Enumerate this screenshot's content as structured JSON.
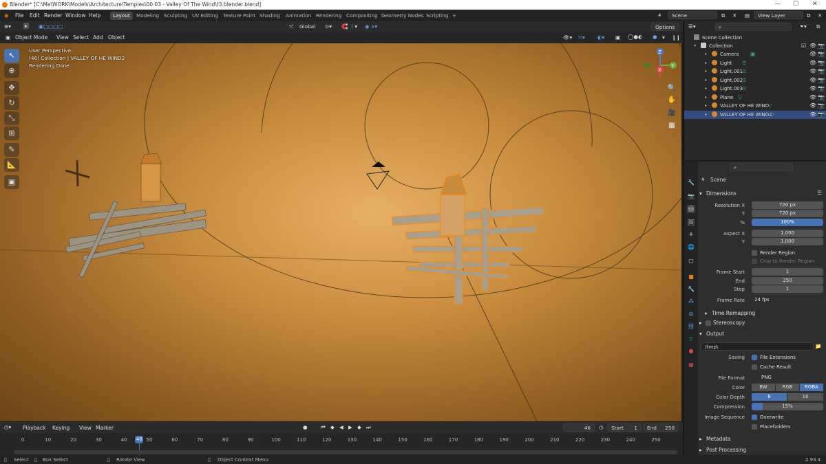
{
  "window": {
    "title": "Blender* [C:\\Me\\WORK\\Models\\Architecture\\Temples\\00.03 - Valley Of The Wind\\t3.blender.blend]",
    "minimize": "—",
    "maximize": "☐",
    "close": "✕"
  },
  "menu": {
    "items": [
      "File",
      "Edit",
      "Render",
      "Window",
      "Help"
    ]
  },
  "workspaces": {
    "tabs": [
      "Layout",
      "Modeling",
      "Sculpting",
      "UV Editing",
      "Texture Paint",
      "Shading",
      "Animation",
      "Rendering",
      "Compositing",
      "Geometry Nodes",
      "Scripting"
    ],
    "active": "Layout",
    "add": "+"
  },
  "scene": {
    "name": "Scene",
    "view_layer": "View Layer"
  },
  "toolbar": {
    "transform_orientation": "Global",
    "options": "Options"
  },
  "viewport_header": {
    "mode": "Object Mode",
    "menus": [
      "View",
      "Select",
      "Add",
      "Object"
    ]
  },
  "viewport": {
    "perspective": "User Perspective",
    "collection_info": "(46) Collection | VALLEY OF HE WIND2",
    "status": "Rendering Done",
    "gizmo": {
      "z": "Z",
      "y": "Y",
      "x": "X"
    }
  },
  "outliner": {
    "root": "Scene Collection",
    "collection": "Collection",
    "items": [
      {
        "name": "Camera",
        "type": "camera",
        "selected": false
      },
      {
        "name": "Light",
        "type": "light",
        "selected": false
      },
      {
        "name": "Light.001",
        "type": "light",
        "selected": false
      },
      {
        "name": "Light.002",
        "type": "light",
        "selected": false
      },
      {
        "name": "Light.003",
        "type": "light",
        "selected": false
      },
      {
        "name": "Plane",
        "type": "mesh",
        "selected": false
      },
      {
        "name": "VALLEY OF HE WIND",
        "type": "mesh",
        "selected": false
      },
      {
        "name": "VALLEY OF HE WIND2",
        "type": "mesh",
        "selected": true
      }
    ]
  },
  "properties": {
    "context": "Scene",
    "dimensions": {
      "header": "Dimensions",
      "resolution_x_label": "Resolution X",
      "resolution_x": "720 px",
      "y_label": "Y",
      "resolution_y": "720 px",
      "pct_label": "%",
      "percent": "100%",
      "aspect_x_label": "Aspect X",
      "aspect_x": "1.000",
      "aspect_y_label": "Y",
      "aspect_y": "1.000",
      "render_region": "Render Region",
      "crop": "Crop to Render Region",
      "frame_start_label": "Frame Start",
      "frame_start": "1",
      "end_label": "End",
      "frame_end": "250",
      "step_label": "Step",
      "step": "1",
      "frame_rate_label": "Frame Rate",
      "frame_rate": "24 fps",
      "time_remapping": "Time Remapping",
      "stereoscopy": "Stereoscopy"
    },
    "output": {
      "header": "Output",
      "path": "/tmp\\",
      "saving_label": "Saving",
      "file_extensions": "File Extensions",
      "cache_result": "Cache Result",
      "file_format_label": "File Format",
      "file_format": "PNG",
      "color_label": "Color",
      "color_options": [
        "BW",
        "RGB",
        "RGBA"
      ],
      "color_selected": "RGBA",
      "depth_label": "Color Depth",
      "depth_options": [
        "8",
        "16"
      ],
      "depth_selected": "8",
      "compression_label": "Compression",
      "compression": "15%",
      "compression_value": 0.15,
      "image_sequence_label": "Image Sequence",
      "overwrite": "Overwrite",
      "placeholders": "Placeholders"
    },
    "metadata": "Metadata",
    "post_processing": "Post Processing"
  },
  "timeline": {
    "menus": [
      "Playback",
      "Keying",
      "View",
      "Marker"
    ],
    "current_frame": "46",
    "start_label": "Start",
    "start": "1",
    "end_label": "End",
    "end": "250",
    "ticks": [
      "0",
      "10",
      "20",
      "30",
      "40",
      "50",
      "60",
      "70",
      "80",
      "90",
      "100",
      "110",
      "120",
      "130",
      "140",
      "150",
      "160",
      "170",
      "180",
      "190",
      "200",
      "210",
      "220",
      "230",
      "240",
      "250"
    ]
  },
  "status": {
    "select": "Select",
    "box_select": "Box Select",
    "rotate_view": "Rotate View",
    "context_menu": "Object Context Menu",
    "version": "2.93.4"
  },
  "colors": {
    "accent": "#4772b3",
    "selection": "#e87d0d",
    "bg": "#1d1d1d"
  }
}
